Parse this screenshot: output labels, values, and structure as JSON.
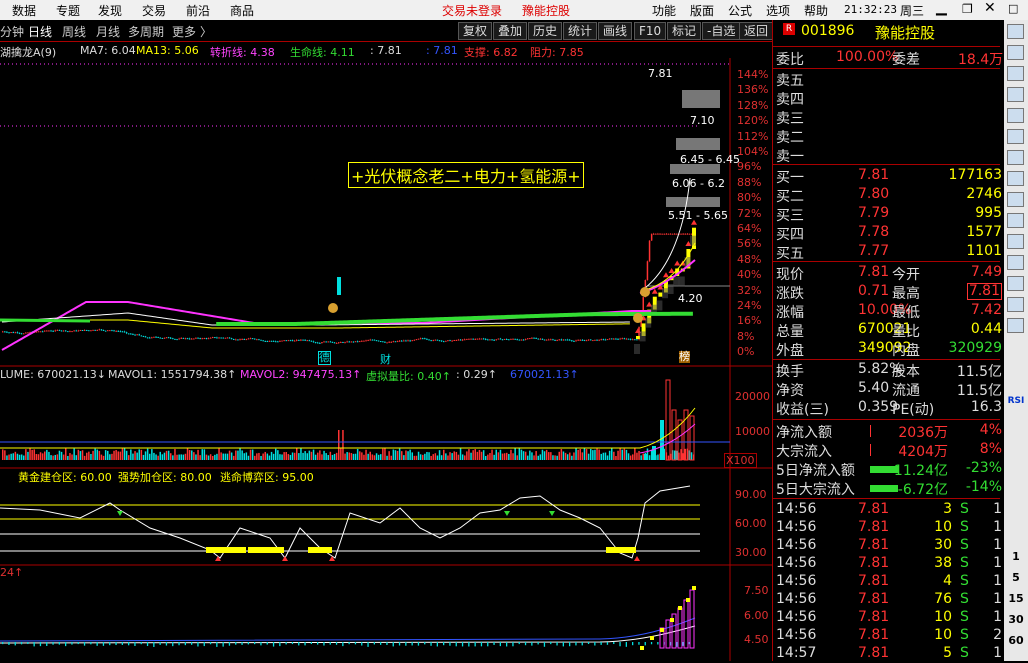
{
  "menu": {
    "items": [
      "数据",
      "专题",
      "发现",
      "交易",
      "前沿",
      "商品"
    ],
    "trade_login": "交易未登录",
    "stock_name": "豫能控股",
    "right_items": [
      "功能",
      "版面",
      "公式",
      "选项",
      "帮助"
    ],
    "time": "21:32:23",
    "weekday": "周三"
  },
  "toolbar": {
    "tabs": [
      "分钟",
      "日线",
      "周线",
      "月线",
      "多周期",
      "更多"
    ],
    "buttons": [
      "复权",
      "叠加",
      "历史",
      "统计",
      "画线",
      "F10",
      "标记",
      "-自选",
      "返回"
    ]
  },
  "ma_legend": {
    "name": "湖擒龙A(9)",
    "ma7": "MA7: 6.04",
    "ma13": "MA13: 5.06",
    "turn": "转折线: 4.38",
    "life": "生命线: 4.11",
    "v1": ": 7.81",
    "v2": ": 7.81",
    "support": "支撑: 6.82",
    "resist": "阻力: 7.85"
  },
  "main_chart": {
    "y_ticks": [
      "144%",
      "136%",
      "128%",
      "120%",
      "112%",
      "104%",
      "96%",
      "88%",
      "80%",
      "72%",
      "64%",
      "56%",
      "48%",
      "40%",
      "32%",
      "24%",
      "16%",
      "8%",
      "0%"
    ],
    "annotation": "+光伏概念老二+电力+氢能源+",
    "price_labels": [
      "7.81",
      "7.10",
      "6.45 - 6.45",
      "6.06 - 6.2",
      "5.51 - 5.65",
      "4.20"
    ],
    "markers": [
      "德",
      "财",
      "榜"
    ]
  },
  "volume": {
    "legend": {
      "vol": "LUME: 670021.13↓",
      "mavol1": "MAVOL1: 1551794.38↑",
      "mavol2": "MAVOL2: 947475.13↑",
      "ratio": "虚拟量比: 0.40↑",
      "r2": ": 0.29↑",
      "r3": "670021.13↑"
    },
    "y_ticks": [
      "20000",
      "10000"
    ],
    "unit": "X100"
  },
  "osc": {
    "legend": {
      "a": "黄金建仓区: 60.00",
      "b": "强势加仓区: 80.00",
      "c": "逃命博弈区: 95.00"
    },
    "y_ticks": [
      "90.00",
      "60.00",
      "30.00"
    ]
  },
  "bottom": {
    "label": "24↑",
    "y_ticks": [
      "7.50",
      "6.00",
      "4.50"
    ]
  },
  "quote": {
    "code": "001896",
    "name": "豫能控股",
    "weibi_label": "委比",
    "weibi": "100.00%",
    "weicha_label": "委差",
    "weicha": "18.4万",
    "asks": [
      {
        "label": "卖五"
      },
      {
        "label": "卖四"
      },
      {
        "label": "卖三"
      },
      {
        "label": "卖二"
      },
      {
        "label": "卖一"
      }
    ],
    "bids": [
      {
        "label": "买一",
        "price": "7.81",
        "vol": "177163"
      },
      {
        "label": "买二",
        "price": "7.80",
        "vol": "2746"
      },
      {
        "label": "买三",
        "price": "7.79",
        "vol": "995"
      },
      {
        "label": "买四",
        "price": "7.78",
        "vol": "1577"
      },
      {
        "label": "买五",
        "price": "7.77",
        "vol": "1101"
      }
    ],
    "stats": [
      [
        "现价",
        "7.81",
        "今开",
        "7.49"
      ],
      [
        "涨跌",
        "0.71",
        "最高",
        "7.81"
      ],
      [
        "涨幅",
        "10.00%",
        "最低",
        "7.42"
      ],
      [
        "总量",
        "670021",
        "量比",
        "0.44"
      ],
      [
        "外盘",
        "349092",
        "内盘",
        "320929"
      ]
    ],
    "stats2": [
      [
        "换手",
        "5.82%",
        "股本",
        "11.5亿"
      ],
      [
        "净资",
        "5.40",
        "流通",
        "11.5亿"
      ],
      [
        "收益(三)",
        "0.359",
        "PE(动)",
        "16.3"
      ]
    ],
    "flows": [
      {
        "label": "净流入额",
        "value": "2036万",
        "pct": "4%"
      },
      {
        "label": "大宗流入",
        "value": "4204万",
        "pct": "8%"
      },
      {
        "label": "5日净流入额",
        "value": "-11.24亿",
        "pct": "-23%"
      },
      {
        "label": "5日大宗流入",
        "value": "-6.72亿",
        "pct": "-14%"
      }
    ],
    "ticks": [
      {
        "t": "14:56",
        "p": "7.81",
        "v": "3",
        "d": "S",
        "n": "1"
      },
      {
        "t": "14:56",
        "p": "7.81",
        "v": "10",
        "d": "S",
        "n": "1"
      },
      {
        "t": "14:56",
        "p": "7.81",
        "v": "30",
        "d": "S",
        "n": "1"
      },
      {
        "t": "14:56",
        "p": "7.81",
        "v": "38",
        "d": "S",
        "n": "1"
      },
      {
        "t": "14:56",
        "p": "7.81",
        "v": "4",
        "d": "S",
        "n": "1"
      },
      {
        "t": "14:56",
        "p": "7.81",
        "v": "76",
        "d": "S",
        "n": "1"
      },
      {
        "t": "14:56",
        "p": "7.81",
        "v": "10",
        "d": "S",
        "n": "1"
      },
      {
        "t": "14:56",
        "p": "7.81",
        "v": "10",
        "d": "S",
        "n": "2"
      },
      {
        "t": "14:57",
        "p": "7.81",
        "v": "5",
        "d": "S",
        "n": "1"
      }
    ]
  },
  "side_icons": [
    "tab-icon",
    "list-icon",
    "grid-icon",
    "chart-icon",
    "book-icon",
    "chart2-icon",
    "note-icon",
    "kline-icon",
    "f10-icon",
    "fa-icon",
    "ff-icon",
    "fz-icon",
    "circle-icon",
    "rsi-icon",
    "pen-icon"
  ],
  "side_labels": [
    "RSI",
    "1",
    "5",
    "15",
    "30",
    "60"
  ],
  "colors": {
    "up": "#ff3333",
    "down": "#00e0e0",
    "ma": "#ffffff",
    "yellow": "#ffff00",
    "magenta": "#ff33ff",
    "green": "#33dd33"
  }
}
